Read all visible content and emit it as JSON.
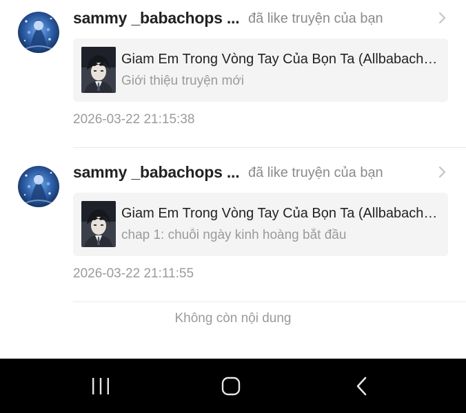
{
  "notifications": [
    {
      "username": "sammy _babachops ...",
      "action": "đã like truyện của bạn",
      "story_title": "Giam Em Trong Vòng Tay Của Bọn Ta (Allbabachops)",
      "story_subtitle": "Giới thiệu truyện mới",
      "timestamp": "2026-03-22 21:15:38",
      "icon": "chevron-right-icon"
    },
    {
      "username": "sammy _babachops ...",
      "action": "đã like truyện của bạn",
      "story_title": "Giam Em Trong Vòng Tay Của Bọn Ta (Allbabachops)",
      "story_subtitle": "chap 1: chuỗi ngày kinh hoàng bắt đầu",
      "timestamp": "2026-03-22 21:11:55",
      "icon": "chevron-right-icon"
    }
  ],
  "end_of_list": "Không còn nội dung",
  "navbar": {
    "recent_icon": "recent-apps-icon",
    "home_icon": "home-icon",
    "back_icon": "back-icon"
  },
  "colors": {
    "card_background": "#f4f4f4",
    "muted_text": "#9a9a9a",
    "navbar_background": "#000000"
  }
}
